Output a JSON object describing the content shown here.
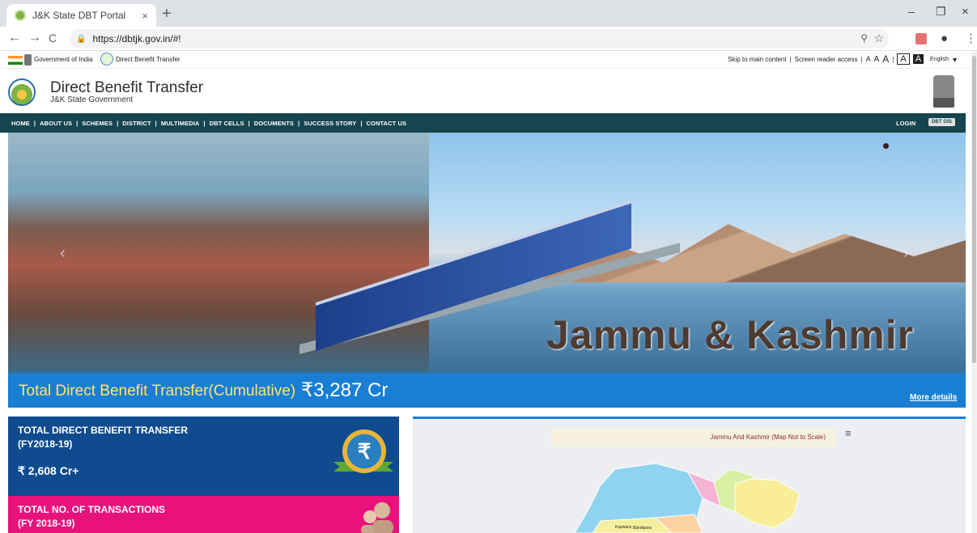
{
  "browser": {
    "tab_title": "J&K State DBT Portal",
    "tab_close": "×",
    "new_tab": "+",
    "url": "https://dbtjk.gov.in/#!",
    "back": "←",
    "forward": "→",
    "reload": "C",
    "minimize": "–",
    "maximize": "❐",
    "close": "×",
    "zoom_icon": "⚲",
    "star_icon": "☆",
    "profile_icon": "●",
    "menu_icon": "⋮"
  },
  "gov_strip": {
    "gov_of_india": "Government of India",
    "dbt_link": "Direct Benefit Transfer",
    "skip": "Skip to main content",
    "sep1": "|",
    "screen_reader": "Screen reader access",
    "sep2": "|",
    "a_small": "A",
    "a_medium": "A",
    "a_large": "A",
    "sep3": "|",
    "contrast_light": "A",
    "contrast_dark": "A",
    "language": "English",
    "lang_arrow": "▼"
  },
  "header": {
    "title": "Direct Benefit Transfer",
    "subtitle": "J&K State Government"
  },
  "nav": {
    "items": [
      "HOME",
      "ABOUT US",
      "SCHEMES",
      "DISTRICT",
      "MULTIMEDIA",
      "DBT CELLS",
      "DOCUMENTS",
      "SUCCESS STORY",
      "CONTACT US"
    ],
    "separator": "|",
    "login": "LOGIN",
    "dbt_gis": "DBT GIS"
  },
  "banner": {
    "caption": "Jammu & Kashmir",
    "prev_arrow": "‹",
    "next_arrow": "›"
  },
  "total": {
    "label": "Total Direct Benefit Transfer(Cumulative)",
    "value": "₹3,287 Cr",
    "more": "More details"
  },
  "cards": {
    "dbt_title": "TOTAL DIRECT BENEFIT TRANSFER",
    "dbt_period": "(FY2018-19)",
    "dbt_value": "₹ 2,608 Cr+",
    "rupee_symbol": "₹",
    "tx_title": "TOTAL NO. OF TRANSACTIONS",
    "tx_period": "(FY 2018-19)"
  },
  "map": {
    "title": "Jammu And Kashmir (Map Not to Scale)",
    "menu_icon": "≡",
    "labels": [
      "Kupwara",
      "Bandipora"
    ]
  },
  "colors": {
    "nav_bg": "#16454f",
    "total_bar": "#1a7fd4",
    "total_label": "#ffe56a",
    "card_blue": "#0f4b8e",
    "card_pink": "#e9127d"
  }
}
